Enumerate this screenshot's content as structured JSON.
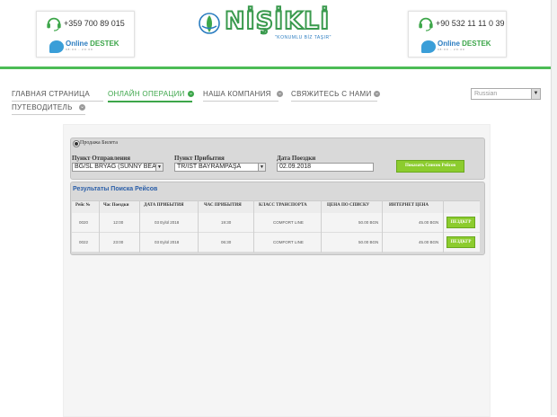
{
  "header": {
    "left_phone": "+359 700 89 015",
    "right_phone": "+90 532 11 11 0 39",
    "online_word": "Online",
    "destek_word": "DESTEK",
    "badge_small": "08:00 - 20:00",
    "logo_text": "NİŞİKLİ",
    "logo_slogan": "\"KONUMLU BİZ TAŞIR\""
  },
  "nav": {
    "items": [
      {
        "label": "ГЛАВНАЯ СТРАНИЦА",
        "active": false
      },
      {
        "label": "ОНЛАЙН ОПЕРАЦИИ",
        "active": true
      },
      {
        "label": "НАША КОМПАНИЯ",
        "active": false
      },
      {
        "label": "СВЯЖИТЕСЬ С НАМИ",
        "active": false
      },
      {
        "label": "ПУТЕВОДИТЕЛЬ",
        "active": false
      }
    ],
    "language": "Russian"
  },
  "search": {
    "mode_label": "Продажа Билета",
    "from_label": "Пункт Отправления",
    "from_value": "BG/SL BRYAG (SUNNY BEA",
    "to_label": "Пункт Прибытия",
    "to_value": "TR/IST BAYRAMPAŞA",
    "date_label": "Дата Поездки",
    "date_value": "02.09.2018",
    "submit_label": "Показать Список Рейсов"
  },
  "results": {
    "title": "Результаты Поиска Рейсов",
    "columns": [
      "Рейс №",
      "Час Поездки",
      "ДАТА ПРИБЫТИЯ",
      "ЧАС ПРИБЫТИЯ",
      "КЛАСС ТРАНСПОРТА",
      "ЦЕНА ПО СПИСКУ",
      "ИНТЕРНЕТ ЦЕНА"
    ],
    "rows": [
      {
        "trip_no": "0020",
        "depart": "12:00",
        "arrive_date": "03 Eylül 2018",
        "arrive_time": "19:30",
        "class": "COMFORT LINE",
        "list_price": "50.00 BGN",
        "web_price": "45.00 BGN",
        "action": "ПЕЗДКГР"
      },
      {
        "trip_no": "0022",
        "depart": "23:00",
        "arrive_date": "03 Eylül 2018",
        "arrive_time": "06:30",
        "class": "COMFORT LINE",
        "list_price": "50.00 BGN",
        "web_price": "45.00 BGN",
        "action": "ПЕЗДКГР"
      }
    ]
  },
  "colors": {
    "brand_green": "#4cbc55",
    "accent_blue": "#2a7cc0",
    "button_green": "#8ccc2e"
  }
}
